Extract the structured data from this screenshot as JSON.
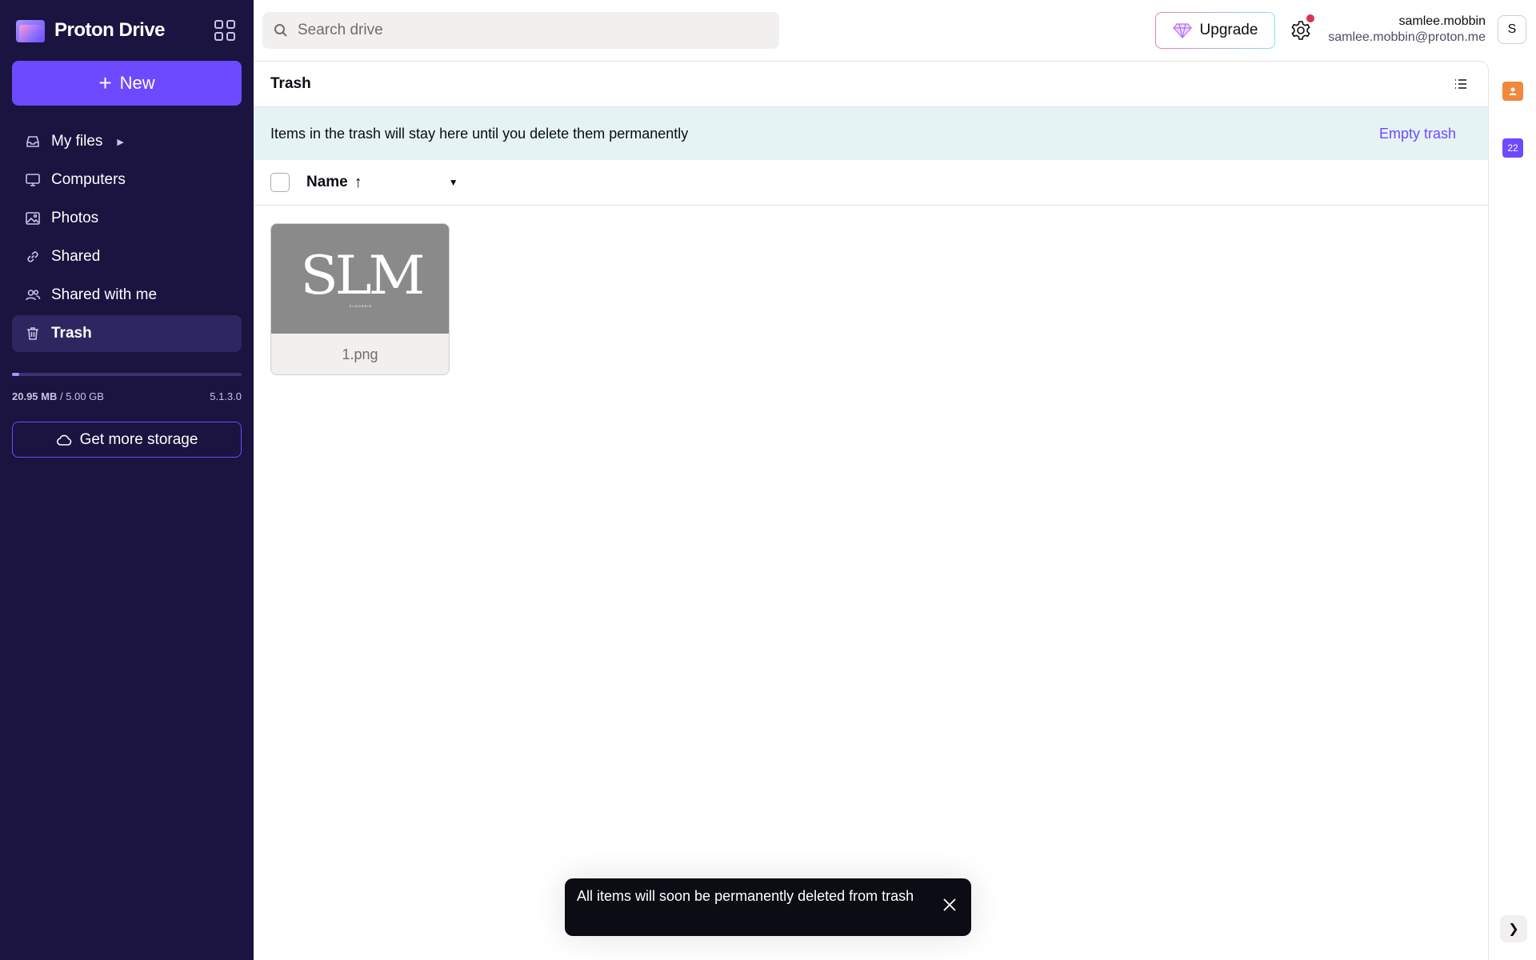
{
  "app": {
    "name": "Proton Drive"
  },
  "sidebar": {
    "new_label": "New",
    "items": [
      {
        "label": "My files",
        "icon": "inbox-icon"
      },
      {
        "label": "Computers",
        "icon": "monitor-icon"
      },
      {
        "label": "Photos",
        "icon": "image-icon"
      },
      {
        "label": "Shared",
        "icon": "link-icon"
      },
      {
        "label": "Shared with me",
        "icon": "users-icon"
      },
      {
        "label": "Trash",
        "icon": "trash-icon",
        "active": true
      }
    ],
    "storage": {
      "used": "20.95 MB",
      "separator": "/",
      "total": "5.00 GB",
      "used_fraction": 0.004
    },
    "version": "5.1.3.0",
    "more_storage_label": "Get more storage"
  },
  "topbar": {
    "search_placeholder": "Search drive",
    "upgrade_label": "Upgrade",
    "user_name": "samlee.mobbin",
    "user_email": "samlee.mobbin@proton.me",
    "avatar_initial": "S"
  },
  "main": {
    "title": "Trash",
    "banner_text": "Items in the trash will stay here until you delete them permanently",
    "empty_trash_label": "Empty trash",
    "name_column": "Name",
    "files": [
      {
        "name": "1.png",
        "thumb_text": "SLM",
        "thumb_subtext": "SLMOBBIN"
      }
    ]
  },
  "drawer": {
    "calendar_day": "22"
  },
  "toast": {
    "message": "All items will soon be permanently deleted from trash"
  },
  "colors": {
    "sidebar_bg": "#1b1340",
    "accent": "#6d4aff",
    "banner_bg": "#e6f3f5",
    "notification_dot": "#dc3251"
  }
}
